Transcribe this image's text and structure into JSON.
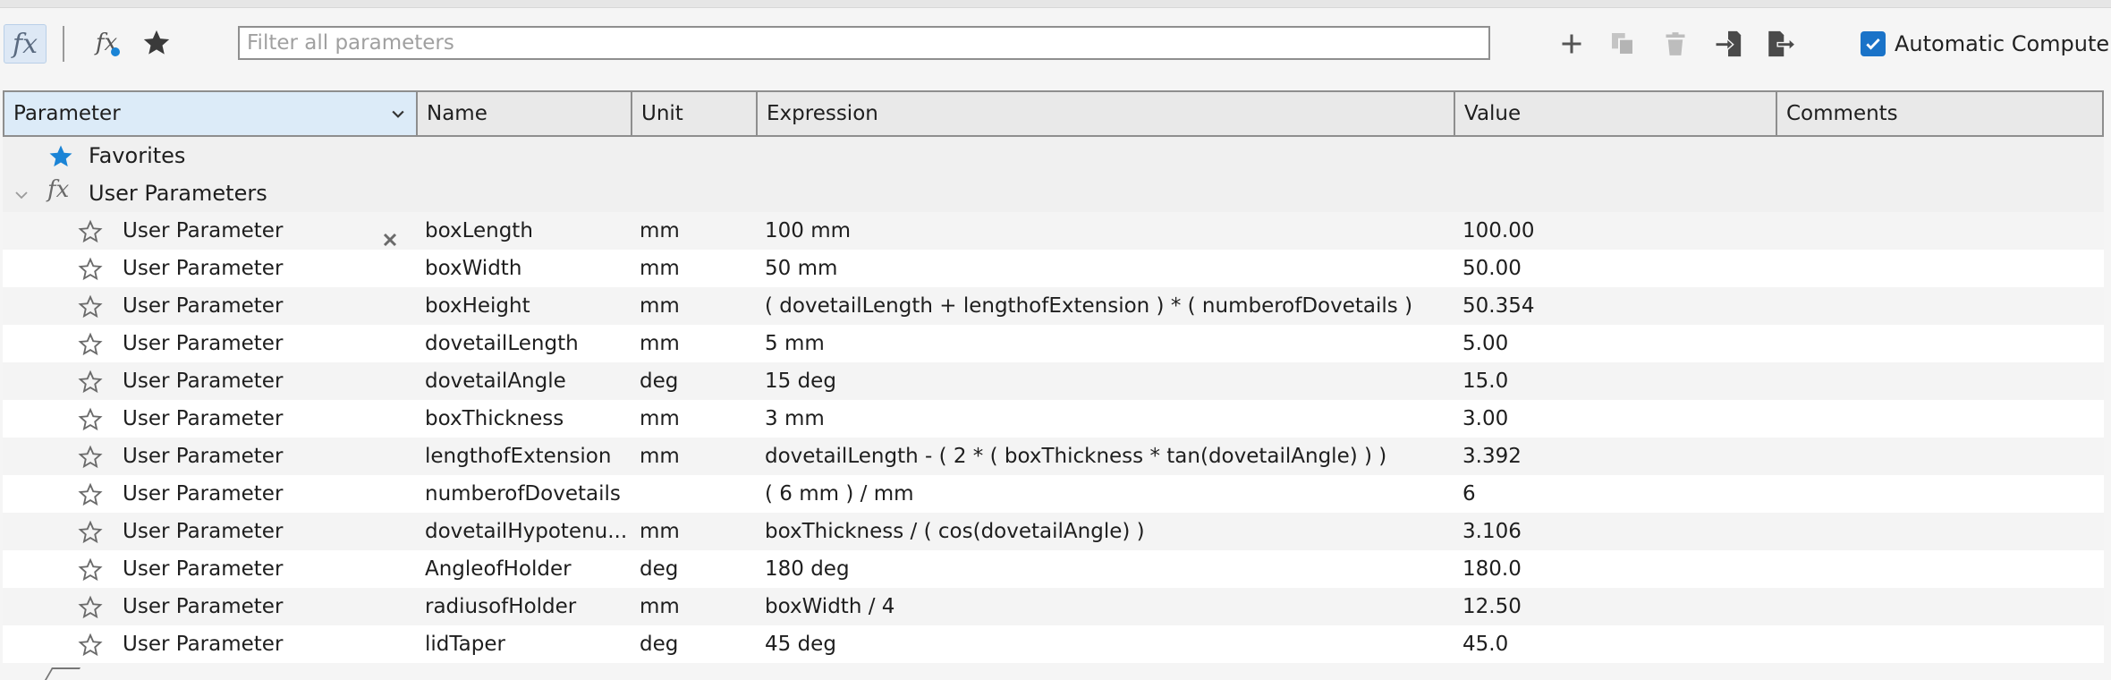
{
  "toolbar": {
    "fx_label": "fx",
    "filter_placeholder": "Filter all parameters",
    "automatic_compute_label": "Automatic Compute",
    "automatic_compute_checked": true
  },
  "columns": [
    "Parameter",
    "Name",
    "Unit",
    "Expression",
    "Value",
    "Comments"
  ],
  "groups": {
    "favorites": "Favorites",
    "user_parameters": "User Parameters"
  },
  "rows": [
    {
      "type": "User Parameter",
      "name": "boxLength",
      "unit": "mm",
      "expression": "100 mm",
      "value": "100.00",
      "comments": ""
    },
    {
      "type": "User Parameter",
      "name": "boxWidth",
      "unit": "mm",
      "expression": "50 mm",
      "value": "50.00",
      "comments": ""
    },
    {
      "type": "User Parameter",
      "name": "boxHeight",
      "unit": "mm",
      "expression": "( dovetailLength + lengthofExtension ) * ( numberofDovetails )",
      "value": "50.354",
      "comments": ""
    },
    {
      "type": "User Parameter",
      "name": "dovetailLength",
      "unit": "mm",
      "expression": "5 mm",
      "value": "5.00",
      "comments": ""
    },
    {
      "type": "User Parameter",
      "name": "dovetailAngle",
      "unit": "deg",
      "expression": "15 deg",
      "value": "15.0",
      "comments": ""
    },
    {
      "type": "User Parameter",
      "name": "boxThickness",
      "unit": "mm",
      "expression": "3 mm",
      "value": "3.00",
      "comments": ""
    },
    {
      "type": "User Parameter",
      "name": "lengthofExtension",
      "unit": "mm",
      "expression": "dovetailLength - ( 2 * ( boxThickness * tan(dovetailAngle) ) )",
      "value": "3.392",
      "comments": ""
    },
    {
      "type": "User Parameter",
      "name": "numberofDovetails",
      "unit": "",
      "expression": "( 6 mm ) / mm",
      "value": "6",
      "comments": ""
    },
    {
      "type": "User Parameter",
      "name": "dovetailHypotenu...",
      "unit": "mm",
      "expression": "boxThickness / ( cos(dovetailAngle) )",
      "value": "3.106",
      "comments": ""
    },
    {
      "type": "User Parameter",
      "name": "AngleofHolder",
      "unit": "deg",
      "expression": "180 deg",
      "value": "180.0",
      "comments": ""
    },
    {
      "type": "User Parameter",
      "name": "radiusofHolder",
      "unit": "mm",
      "expression": "boxWidth / 4",
      "value": "12.50",
      "comments": ""
    },
    {
      "type": "User Parameter",
      "name": "lidTaper",
      "unit": "deg",
      "expression": "45 deg",
      "value": "45.0",
      "comments": ""
    }
  ],
  "colors": {
    "accent_blue": "#1a84d6",
    "header_selected": "#dcebf8",
    "checkbox": "#1a73c8"
  },
  "icons": [
    "fx-icon",
    "user-fx-icon",
    "favorites-star-icon",
    "add-icon",
    "copy-icon",
    "delete-icon",
    "import-icon",
    "export-icon",
    "checkbox-icon",
    "chevron-down-icon",
    "star-outline-icon",
    "delete-x-icon"
  ]
}
